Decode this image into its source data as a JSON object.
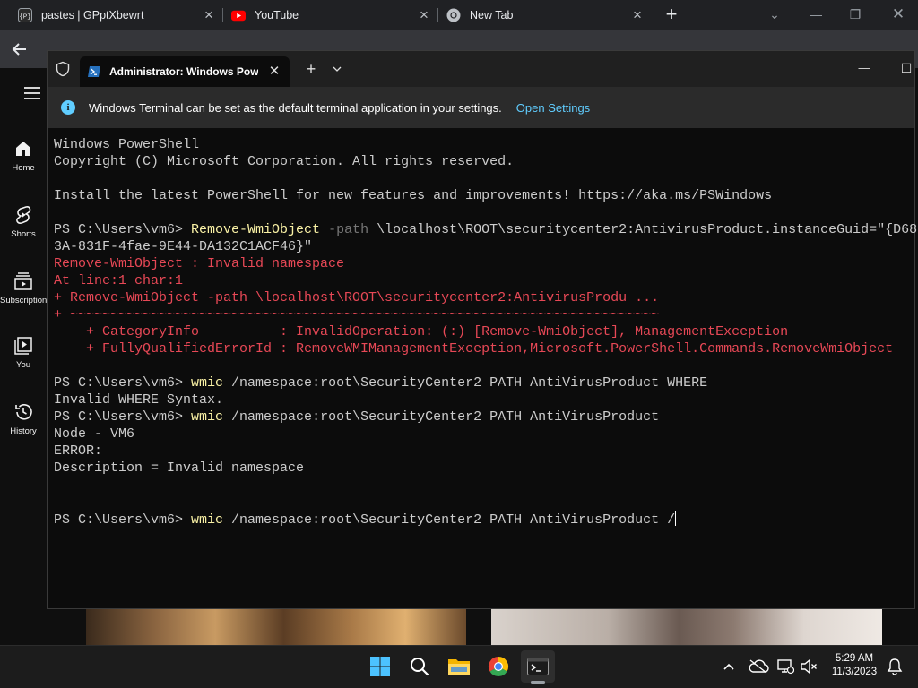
{
  "browser": {
    "tabs": [
      {
        "title": "pastes | GPptXbewrt",
        "icon": "pastes-favicon"
      },
      {
        "title": "YouTube",
        "icon": "youtube-favicon"
      },
      {
        "title": "New Tab",
        "icon": "chrome-favicon"
      }
    ],
    "pastes_favicon_text": "{P}"
  },
  "youtube": {
    "sidebar": [
      {
        "label": "Home",
        "icon": "home-icon"
      },
      {
        "label": "Shorts",
        "icon": "shorts-icon"
      },
      {
        "label": "Subscriptions",
        "icon": "subscriptions-icon"
      },
      {
        "label": "You",
        "icon": "you-library-icon"
      },
      {
        "label": "History",
        "icon": "history-icon"
      }
    ]
  },
  "terminal": {
    "tab_title": "Administrator: Windows PowerShell",
    "infobar": {
      "message": "Windows Terminal can be set as the default terminal application in your settings.",
      "link": "Open Settings"
    },
    "lines": [
      [
        {
          "t": "Windows PowerShell",
          "c": "w"
        }
      ],
      [
        {
          "t": "Copyright (C) Microsoft Corporation. All rights reserved.",
          "c": "w"
        }
      ],
      [],
      [
        {
          "t": "Install the latest PowerShell for new features and improvements! https://aka.ms/PSWindows",
          "c": "w"
        }
      ],
      [],
      [
        {
          "t": "PS C:\\Users\\vm6> ",
          "c": "w"
        },
        {
          "t": "Remove-WmiObject",
          "c": "y"
        },
        {
          "t": " -path",
          "c": "g"
        },
        {
          "t": " \\localhost\\ROOT\\securitycenter2:AntivirusProduct.instanceGuid=\"{D68",
          "c": "w"
        }
      ],
      [
        {
          "t": "3A-831F-4fae-9E44-DA132C1ACF46}\"",
          "c": "w"
        }
      ],
      [
        {
          "t": "Remove-WmiObject : Invalid namespace",
          "c": "r"
        }
      ],
      [
        {
          "t": "At line:1 char:1",
          "c": "r"
        }
      ],
      [
        {
          "t": "+ Remove-WmiObject -path \\localhost\\ROOT\\securitycenter2:AntivirusProdu ...",
          "c": "r"
        }
      ],
      [
        {
          "t": "+ ~~~~~~~~~~~~~~~~~~~~~~~~~~~~~~~~~~~~~~~~~~~~~~~~~~~~~~~~~~~~~~~~~~~~~~~~~",
          "c": "r"
        }
      ],
      [
        {
          "t": "    + CategoryInfo          : InvalidOperation: (:) [Remove-WmiObject], ManagementException",
          "c": "r"
        }
      ],
      [
        {
          "t": "    + FullyQualifiedErrorId : RemoveWMIManagementException,Microsoft.PowerShell.Commands.RemoveWmiObject",
          "c": "r"
        }
      ],
      [],
      [
        {
          "t": "PS C:\\Users\\vm6> ",
          "c": "w"
        },
        {
          "t": "wmic",
          "c": "y"
        },
        {
          "t": " /namespace:root\\SecurityCenter2 PATH AntiVirusProduct WHERE",
          "c": "w"
        }
      ],
      [
        {
          "t": "Invalid WHERE Syntax.",
          "c": "w"
        }
      ],
      [
        {
          "t": "PS C:\\Users\\vm6> ",
          "c": "w"
        },
        {
          "t": "wmic",
          "c": "y"
        },
        {
          "t": " /namespace:root\\SecurityCenter2 PATH AntiVirusProduct",
          "c": "w"
        }
      ],
      [
        {
          "t": "Node - VM6",
          "c": "w"
        }
      ],
      [
        {
          "t": "ERROR:",
          "c": "w"
        }
      ],
      [
        {
          "t": "Description = Invalid namespace",
          "c": "w"
        }
      ],
      [],
      [],
      [
        {
          "t": "PS C:\\Users\\vm6> ",
          "c": "w"
        },
        {
          "t": "wmic",
          "c": "y"
        },
        {
          "t": " /namespace:root\\SecurityCenter2 PATH AntiVirusProduct /",
          "c": "w"
        },
        {
          "cursor": true
        }
      ]
    ]
  },
  "taskbar": {
    "apps": [
      "start-icon",
      "search-icon",
      "file-explorer-icon",
      "chrome-icon",
      "terminal-icon"
    ],
    "tray": [
      "chevron-up-icon",
      "cloud-icon",
      "network-icon",
      "volume-muted-icon"
    ],
    "clock": {
      "time": "5:29 AM",
      "date": "11/3/2023"
    },
    "notification_icon": "notification-bell-icon"
  },
  "colors": {
    "terminal_bg": "#0c0c0c",
    "text_white": "#cccccc",
    "text_yellow": "#f9f1a5",
    "text_gray": "#767676",
    "text_red": "#e74856",
    "link_blue": "#60cdff",
    "youtube_red": "#ff0000"
  }
}
